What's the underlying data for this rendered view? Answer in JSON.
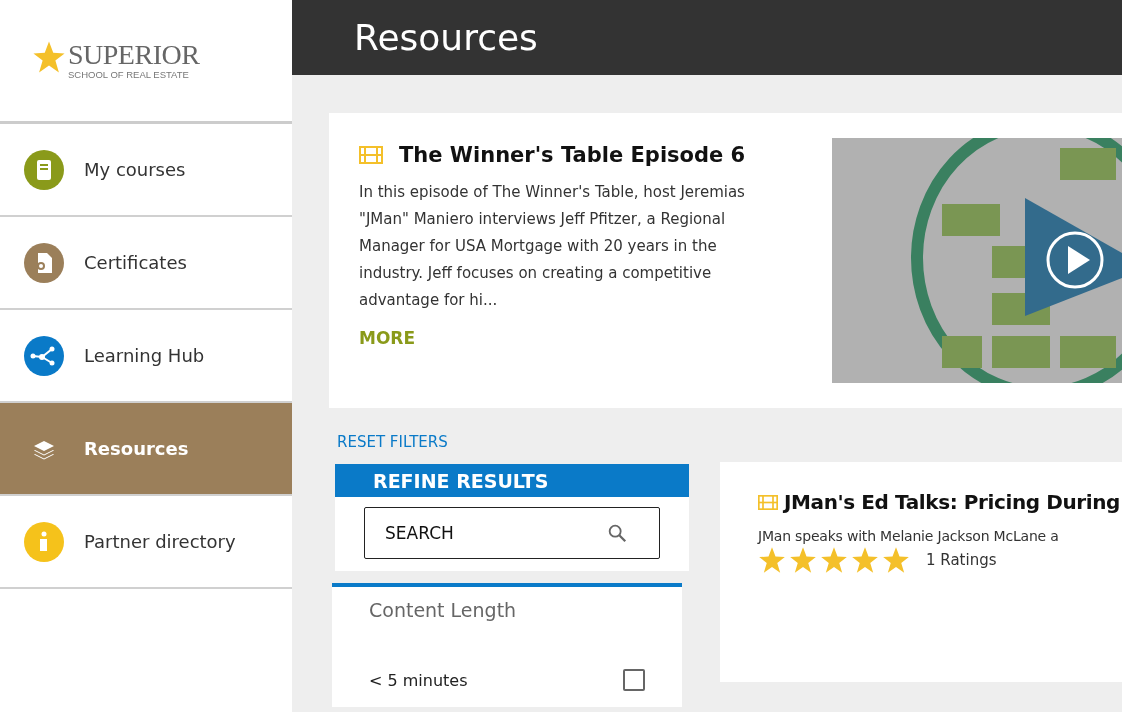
{
  "logo": {
    "name": "SUPERIOR",
    "tagline": "SCHOOL OF REAL ESTATE"
  },
  "sidebar": {
    "items": [
      {
        "label": "My courses",
        "kind": "book",
        "selected": false
      },
      {
        "label": "Certificates",
        "kind": "certificate",
        "selected": false
      },
      {
        "label": "Learning Hub",
        "kind": "hub",
        "selected": false
      },
      {
        "label": "Resources",
        "kind": "layers",
        "selected": true
      },
      {
        "label": "Partner directory",
        "kind": "info",
        "selected": false
      }
    ]
  },
  "header": {
    "title": "Resources"
  },
  "featured": {
    "title": "The Winner's Table Episode 6",
    "description": "In this episode of The Winner's Table, host Jeremias \"JMan\" Maniero interviews Jeff Pfitzer, a Regional Manager for USA Mortgage with 20 years in the industry. Jeff focuses on creating a competitive advantage for hi...",
    "more": "MORE"
  },
  "reset_filters": "RESET FILTERS",
  "refine": {
    "title": "REFINE RESULTS",
    "search": {
      "placeholder": "SEARCH"
    }
  },
  "content_length": {
    "title": "Content Length",
    "options": [
      {
        "label": "< 5 minutes",
        "checked": false
      }
    ]
  },
  "results": [
    {
      "title": "JMan's Ed Talks: Pricing During",
      "description": "JMan speaks with Melanie Jackson McLane a",
      "stars": 5,
      "ratings": "1 Ratings"
    }
  ]
}
